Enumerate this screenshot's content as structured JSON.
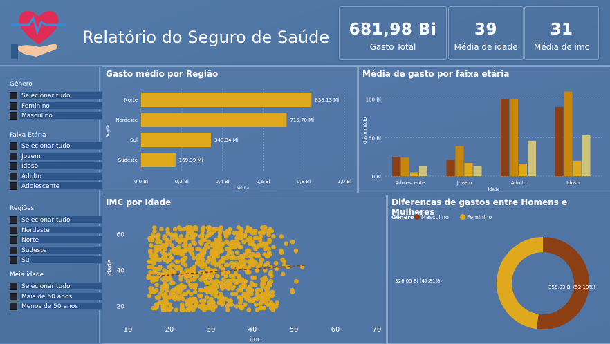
{
  "header": {
    "title": "Relatório do Seguro de Saúde"
  },
  "kpis": [
    {
      "value": "681,98 Bi",
      "label": "Gasto Total"
    },
    {
      "value": "39",
      "label": "Média de idade"
    },
    {
      "value": "31",
      "label": "Média de imc"
    }
  ],
  "slicers": {
    "genero": {
      "title": "Gênero",
      "options": [
        "Selecionar tudo",
        "Feminino",
        "Masculino"
      ]
    },
    "faixa": {
      "title": "Faixa Etária",
      "options": [
        "Selecionar tudo",
        "Jovem",
        "Idoso",
        "Adulto",
        "Adolescente"
      ]
    },
    "regioes": {
      "title": "Regiões",
      "options": [
        "Selecionar tudo",
        "Nordeste",
        "Norte",
        "Sudeste",
        "Sul"
      ]
    },
    "meia": {
      "title": "Meia idade",
      "options": [
        "Selecionar tudo",
        "Mais de 50 anos",
        "Menos de 50 anos"
      ]
    }
  },
  "colors": {
    "gold": "#e0a81c",
    "brown": "#8b3f12",
    "amber": "#c8860a",
    "khaki": "#cfc27a"
  },
  "chart_data": [
    {
      "type": "bar",
      "title": "Gasto médio por Região",
      "categories": [
        "Norte",
        "Nordeste",
        "Sul",
        "Sudeste"
      ],
      "values": [
        838.13,
        715.7,
        343.34,
        169.39
      ],
      "labels": [
        "838,13 Mi",
        "715,70 Mi",
        "343,34 Mi",
        "169,39 Mi"
      ],
      "xlabel": "Média",
      "ylabel": "Região",
      "xticks": [
        "0,0 Bi",
        "0,2 Bi",
        "0,4 Bi",
        "0,6 Bi",
        "0,8 Bi",
        "1,0 Bi"
      ],
      "xlim": [
        0,
        1.0
      ]
    },
    {
      "type": "bar",
      "title": "Média de gasto por faixa etária",
      "categories": [
        "Adolescente",
        "Jovem",
        "Adulto",
        "Idoso"
      ],
      "series": [
        {
          "values": [
            25,
            21,
            100,
            90
          ]
        },
        {
          "values": [
            24,
            39,
            100,
            110
          ]
        },
        {
          "values": [
            5,
            17,
            16,
            20
          ]
        },
        {
          "values": [
            13,
            13,
            46,
            53
          ]
        }
      ],
      "xlabel": "Idade",
      "ylabel": "Gasto médio",
      "yticks": [
        "0 Bi",
        "50 Bi",
        "100 Bi"
      ],
      "ylim": [
        0,
        115
      ]
    },
    {
      "type": "scatter",
      "title": "IMC por Idade",
      "xlabel": "imc",
      "ylabel": "idade",
      "xticks": [
        "10",
        "20",
        "30",
        "40",
        "50",
        "60",
        "70"
      ],
      "yticks": [
        "20",
        "40",
        "60"
      ],
      "xlim": [
        10,
        70
      ],
      "ylim": [
        14,
        68
      ],
      "trend": [
        [
          17,
          37
        ],
        [
          53,
          43
        ]
      ]
    },
    {
      "type": "pie",
      "title": "Diferenças de gastos entre Homens e Mulheres",
      "legend_title": "Gênero",
      "series": [
        {
          "name": "Masculino",
          "value": 355.93,
          "label": "355,93 Bi (52,19%)"
        },
        {
          "name": "Feminino",
          "value": 326.05,
          "label": "326,05 Bi (47,81%)"
        }
      ]
    }
  ]
}
